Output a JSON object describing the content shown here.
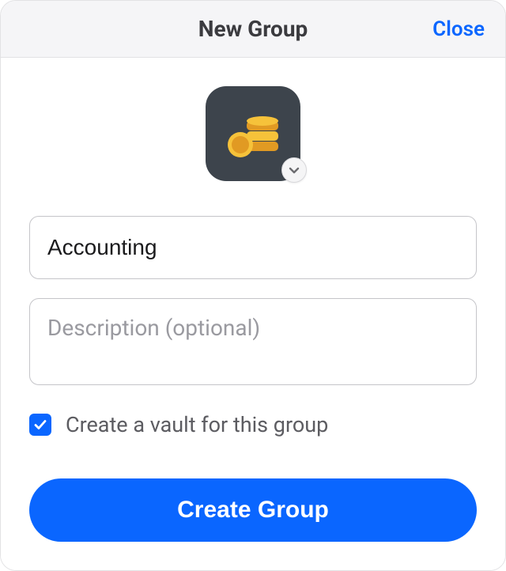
{
  "header": {
    "title": "New Group",
    "close_label": "Close"
  },
  "icon": {
    "name": "coins-icon"
  },
  "form": {
    "name_value": "Accounting",
    "description_value": "",
    "description_placeholder": "Description (optional)",
    "create_vault_checked": true,
    "create_vault_label": "Create a vault for this group",
    "submit_label": "Create Group"
  }
}
